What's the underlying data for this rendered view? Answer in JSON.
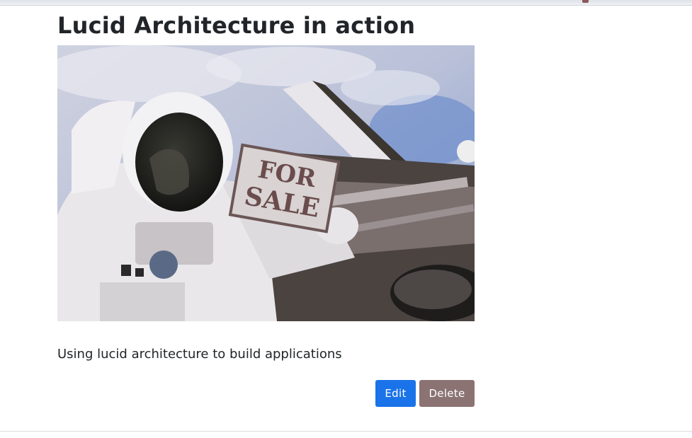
{
  "post": {
    "title": "Lucid Architecture in action",
    "image_sign_line1": "FOR",
    "image_sign_line2": "SALE",
    "body": "Using lucid architecture to build applications"
  },
  "actions": {
    "edit_label": "Edit",
    "delete_label": "Delete"
  },
  "colors": {
    "edit_button": "#1a73e8",
    "delete_button": "#8b7373"
  }
}
